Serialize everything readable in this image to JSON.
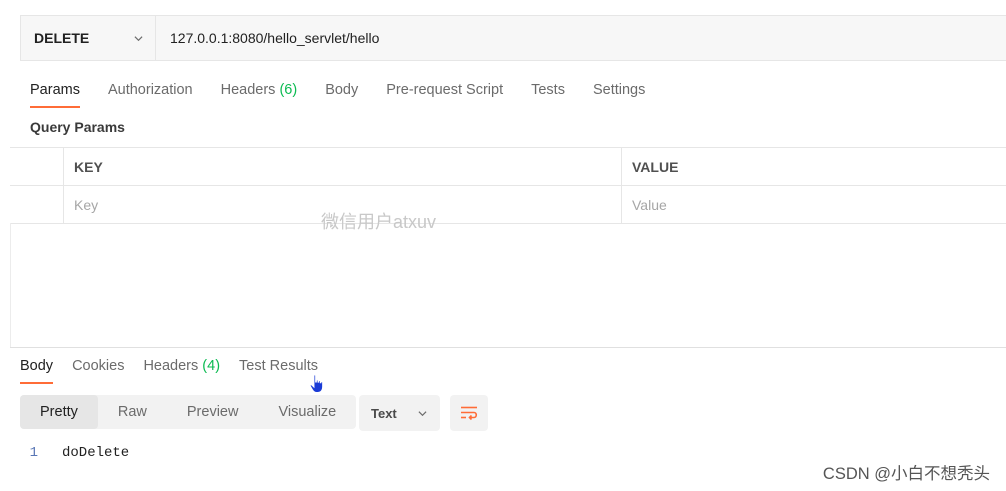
{
  "request": {
    "method": "DELETE",
    "url": "127.0.0.1:8080/hello_servlet/hello"
  },
  "request_tabs": [
    {
      "label": "Params",
      "active": true
    },
    {
      "label": "Authorization"
    },
    {
      "label": "Headers",
      "count": "(6)"
    },
    {
      "label": "Body"
    },
    {
      "label": "Pre-request Script"
    },
    {
      "label": "Tests"
    },
    {
      "label": "Settings"
    }
  ],
  "query_params": {
    "title": "Query Params",
    "columns": {
      "key": "KEY",
      "value": "VALUE"
    },
    "placeholder": {
      "key": "Key",
      "value": "Value"
    }
  },
  "response_tabs": [
    {
      "label": "Body",
      "active": true
    },
    {
      "label": "Cookies"
    },
    {
      "label": "Headers",
      "count": "(4)"
    },
    {
      "label": "Test Results"
    }
  ],
  "view_modes": [
    "Pretty",
    "Raw",
    "Preview",
    "Visualize"
  ],
  "format": "Text",
  "response_body": {
    "line_number": "1",
    "text": "doDelete"
  },
  "watermarks": {
    "center": "微信用户atxuv",
    "corner": "CSDN @小白不想秃头"
  },
  "colors": {
    "accent": "#ff6c37",
    "count_green": "#0cbb52"
  }
}
